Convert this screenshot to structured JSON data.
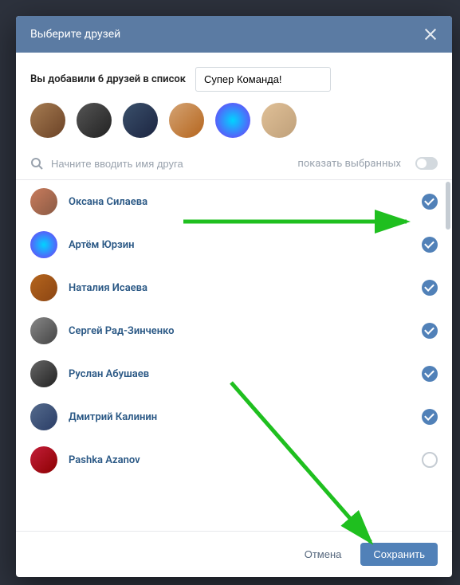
{
  "modal": {
    "title": "Выберите друзей",
    "added_label": "Вы добавили 6 друзей в список",
    "list_name": "Супер Команда!"
  },
  "search": {
    "placeholder": "Начните вводить имя друга",
    "show_selected_label": "показать выбранных"
  },
  "selected_avatars": [
    {
      "cls": "av1"
    },
    {
      "cls": "av2"
    },
    {
      "cls": "av3"
    },
    {
      "cls": "av4"
    },
    {
      "cls": "av5"
    },
    {
      "cls": "av6"
    }
  ],
  "friends": [
    {
      "name": "Оксана Силаева",
      "selected": true,
      "cls": "fa1"
    },
    {
      "name": "Артём Юрзин",
      "selected": true,
      "cls": "fa2"
    },
    {
      "name": "Наталия Исаева",
      "selected": true,
      "cls": "fa3"
    },
    {
      "name": "Сергей Рад-Зинченко",
      "selected": true,
      "cls": "fa4"
    },
    {
      "name": "Руслан Абушаев",
      "selected": true,
      "cls": "fa5"
    },
    {
      "name": "Дмитрий Калинин",
      "selected": true,
      "cls": "fa6"
    },
    {
      "name": "Pashka Azanov",
      "selected": false,
      "cls": "fa7"
    }
  ],
  "footer": {
    "cancel_label": "Отмена",
    "save_label": "Сохранить"
  }
}
